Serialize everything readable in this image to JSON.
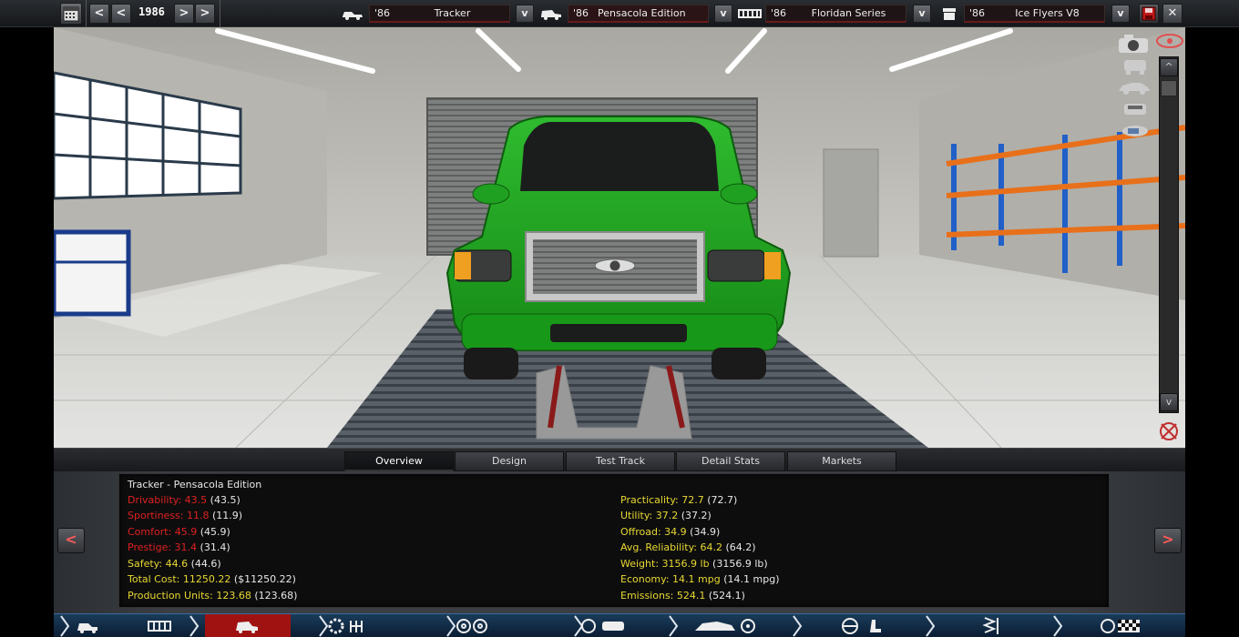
{
  "topbar": {
    "calendar_icon": "calendar-icon",
    "first_label": "<",
    "prev_label": "<",
    "year": "1986",
    "next_label": ">",
    "last_label": ">",
    "model": {
      "year": "'86",
      "name": "Tracker"
    },
    "trim": {
      "year": "'86",
      "name": "Pensacola Edition"
    },
    "chassis": {
      "year": "'86",
      "name": "Floridan Series"
    },
    "engine": {
      "year": "'86",
      "name": "Ice Flyers V8"
    },
    "dropdown_label": "v",
    "colors": {
      "accent_red": "#6a1a1a",
      "save_red": "#c01818"
    }
  },
  "viewport": {
    "car_color": "#1f9a1f",
    "tools": [
      "camera-icon",
      "eye-icon",
      "car-front-icon",
      "car-side-icon",
      "car-rear-icon",
      "car-top-icon"
    ],
    "scroll_up": "^",
    "scroll_down": "v"
  },
  "tabs": [
    {
      "label": "Overview",
      "active": true
    },
    {
      "label": "Design",
      "active": false
    },
    {
      "label": "Test Track",
      "active": false
    },
    {
      "label": "Detail Stats",
      "active": false
    },
    {
      "label": "Markets",
      "active": false
    }
  ],
  "stats": {
    "title": "Tracker - Pensacola Edition",
    "left": [
      {
        "label": "Drivability: 43.5",
        "extra": " (43.5)",
        "color": "red"
      },
      {
        "label": "Sportiness: 11.8",
        "extra": " (11.9)",
        "color": "red"
      },
      {
        "label": "Comfort: 45.9",
        "extra": " (45.9)",
        "color": "red"
      },
      {
        "label": "Prestige: 31.4",
        "extra": " (31.4)",
        "color": "red"
      },
      {
        "label": "Safety: 44.6",
        "extra": " (44.6)",
        "color": "yellow"
      },
      {
        "label": "Total Cost: 11250.22",
        "extra": " ($11250.22)",
        "color": "yellow"
      },
      {
        "label": "Production Units: 123.68",
        "extra": " (123.68)",
        "color": "yellow"
      }
    ],
    "right": [
      {
        "label": "Practicality: 72.7",
        "extra": " (72.7)",
        "color": "yellow"
      },
      {
        "label": "Utility: 37.2",
        "extra": " (37.2)",
        "color": "yellow"
      },
      {
        "label": "Offroad: 34.9",
        "extra": " (34.9)",
        "color": "yellow"
      },
      {
        "label": "Avg. Reliability: 64.2",
        "extra": " (64.2)",
        "color": "yellow"
      },
      {
        "label": "Weight: 3156.9 lb",
        "extra": " (3156.9 lb)",
        "color": "yellow"
      },
      {
        "label": "Economy: 14.1 mpg",
        "extra": " (14.1 mpg)",
        "color": "yellow"
      },
      {
        "label": "Emissions: 524.1",
        "extra": " (524.1)",
        "color": "yellow"
      }
    ]
  },
  "panel_nav": {
    "prev_label": "<",
    "next_label": ">"
  },
  "bottom_nav": [
    {
      "icon": "car-side-icon",
      "active": false
    },
    {
      "icon": "chassis-icon",
      "active": false
    },
    {
      "icon": "trim-icon",
      "active": true
    },
    {
      "icon": "wheel-gear-icon",
      "active": false
    },
    {
      "icon": "tires-icon",
      "active": false
    },
    {
      "icon": "brakes-icon",
      "active": false
    },
    {
      "icon": "body-fan-icon",
      "active": false
    },
    {
      "icon": "interior-icon",
      "active": false
    },
    {
      "icon": "suspension-icon",
      "active": false
    },
    {
      "icon": "finish-icon",
      "active": false
    }
  ]
}
